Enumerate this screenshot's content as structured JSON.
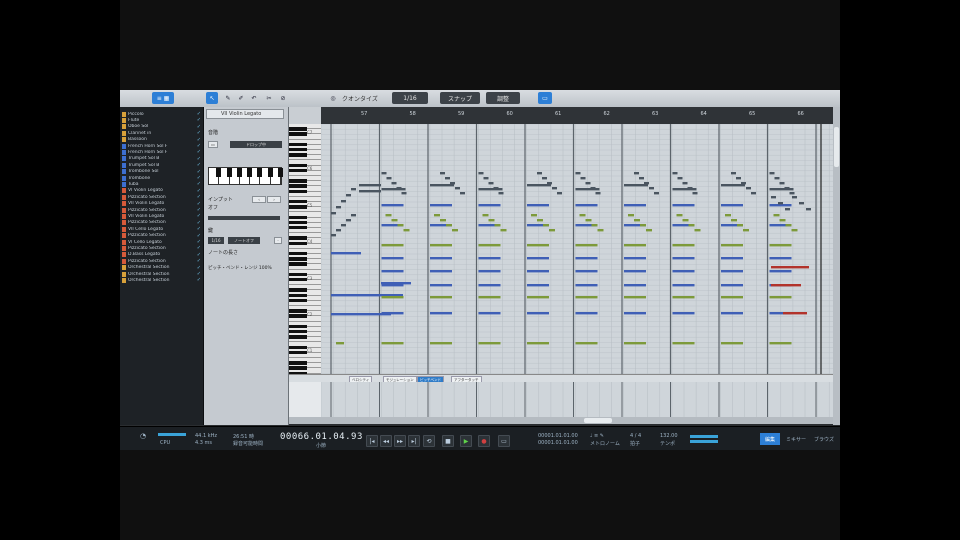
{
  "toolbar": {
    "quantize_label": "クオンタイズ",
    "field1": "1/16",
    "field2": "1/16",
    "field3": "バー",
    "snap_top": "スナップ",
    "snap_bottom": "クオンタイズ",
    "mode_top": "調整",
    "mode_bottom": "フレーズ"
  },
  "tracks": [
    {
      "name": "Piccolo",
      "color": "#d8a13a"
    },
    {
      "name": "Flute",
      "color": "#d8a13a"
    },
    {
      "name": "Oboe Sol",
      "color": "#d8a13a"
    },
    {
      "name": "Clarinet in",
      "color": "#d8a13a"
    },
    {
      "name": "Bassoon",
      "color": "#d8a13a"
    },
    {
      "name": "French Horn Sol F",
      "color": "#3d6fd1"
    },
    {
      "name": "French Horn Sol F",
      "color": "#3d6fd1"
    },
    {
      "name": "Trumpet Sol B",
      "color": "#3d6fd1"
    },
    {
      "name": "Trumpet Sol B",
      "color": "#3d6fd1"
    },
    {
      "name": "Trombone Sol",
      "color": "#3d6fd1"
    },
    {
      "name": "Trombone",
      "color": "#3d6fd1"
    },
    {
      "name": "Tuba",
      "color": "#3d6fd1"
    },
    {
      "name": "VI Violin Legato",
      "color": "#d65a3a"
    },
    {
      "name": "Pizzicato Section",
      "color": "#d65a3a"
    },
    {
      "name": "VII Violin Legato",
      "color": "#d65a3a"
    },
    {
      "name": "Pizzicato Section",
      "color": "#d65a3a"
    },
    {
      "name": "VII Violin Legato",
      "color": "#d65a3a"
    },
    {
      "name": "Pizzicato Section",
      "color": "#d65a3a"
    },
    {
      "name": "VII Cello Legato",
      "color": "#d65a3a"
    },
    {
      "name": "Pizzicato Section",
      "color": "#d65a3a"
    },
    {
      "name": "VI Cello Legato",
      "color": "#d65a3a"
    },
    {
      "name": "Pizzicato Section",
      "color": "#d65a3a"
    },
    {
      "name": "D.Bass Legato",
      "color": "#d65a3a"
    },
    {
      "name": "Pizzicato Section",
      "color": "#d65a3a"
    },
    {
      "name": "Orchestral Section",
      "color": "#d8a13a"
    },
    {
      "name": "Orchestral Section",
      "color": "#d8a13a"
    },
    {
      "name": "Orchestral Section",
      "color": "#d8a13a"
    }
  ],
  "inspector": {
    "instrument": "VII Violin Legato",
    "scale_label": "音階",
    "scale_field": "ドロップ中",
    "input_label": "インプット",
    "input_value": "オフ",
    "key_label": "鍵",
    "length_label": "ノートの長さ",
    "btn_a": "1/16",
    "btn_b": "ノートオフ",
    "apply_label": "ノートの長さ",
    "pitch_label": "ピッチ・ベンド・レンジ 100%",
    "mode_a": "オン",
    "mode_b": "オフ"
  },
  "piano_labels": [
    "C7",
    "C6",
    "C5",
    "C4",
    "C3",
    "C2",
    "C1"
  ],
  "ruler_marks": [
    "57",
    "58",
    "59",
    "60",
    "61",
    "62",
    "63",
    "64",
    "65",
    "66"
  ],
  "lanes": {
    "tabs": [
      "ベロシティ",
      "モジュレーション",
      "ピッチベンド",
      "アフタータッチ"
    ],
    "vel_left": "ベロシティ"
  },
  "transport": {
    "cpu": "CPU",
    "rate_top": "44.1 kHz",
    "rate_bottom": "4.3 ms",
    "dur_top": "26:51 時",
    "dur_bottom": "録音可能時間",
    "time": "00066.01.04.93",
    "time_sub": "小節",
    "loc_top": "00001.01.01.00",
    "loc_bottom": "00001.01.01.00",
    "loop_label": "メトロノーム",
    "tempo_top": "4 / 4",
    "tempo_label": "拍子",
    "bpm": "132.00",
    "bpm_label": "テンポ",
    "edit_btn": "編集",
    "mix_btn": "ミキサー",
    "browse_btn": "ブラウズ"
  },
  "colors": {
    "note_blue": "#3f5fb6",
    "note_green": "#7d9a3a",
    "note_red": "#b2332b",
    "accent": "#2d7fd6"
  }
}
